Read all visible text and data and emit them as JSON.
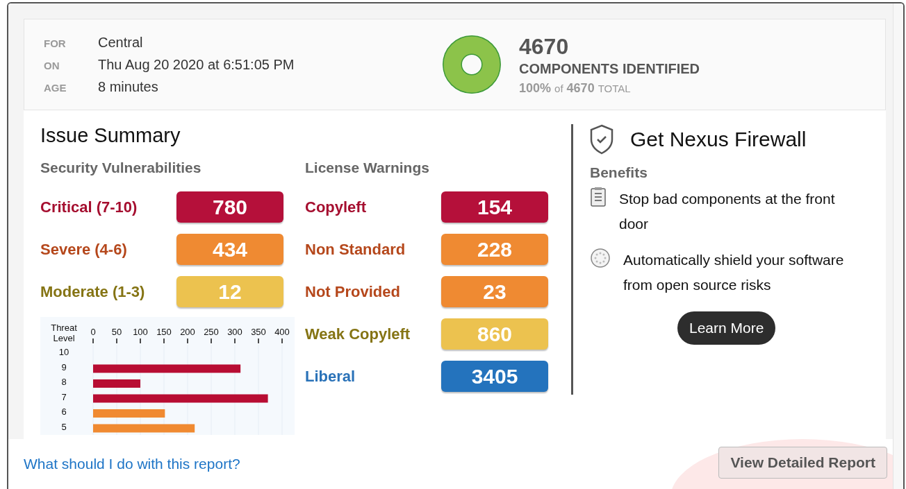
{
  "header": {
    "meta": [
      {
        "label": "FOR",
        "value": "Central"
      },
      {
        "label": "ON",
        "value": "Thu Aug 20 2020 at 6:51:05 PM"
      },
      {
        "label": "AGE",
        "value": "8 minutes"
      }
    ],
    "components": {
      "count": "4670",
      "title": "COMPONENTS IDENTIFIED",
      "percent": "100%",
      "of": "of",
      "total": "4670",
      "total_label": "TOTAL",
      "level": 1
    }
  },
  "issue_summary": {
    "title": "Issue Summary",
    "security": {
      "title": "Security Vulnerabilities",
      "rows": [
        {
          "label": "Critical (7-10)",
          "count": "780",
          "kind": "critical",
          "color": "#b5103a"
        },
        {
          "label": "Severe (4-6)",
          "count": "434",
          "kind": "severe",
          "color": "#ef8a32"
        },
        {
          "label": "Moderate (1-3)",
          "count": "12",
          "kind": "moderate",
          "color": "#ecc24f"
        }
      ]
    },
    "license": {
      "title": "License Warnings",
      "rows": [
        {
          "label": "Copyleft",
          "count": "154",
          "kind": "critical",
          "color": "#b5103a"
        },
        {
          "label": "Non Standard",
          "count": "228",
          "kind": "severe",
          "color": "#ef8a32"
        },
        {
          "label": "Not Provided",
          "count": "23",
          "kind": "severe",
          "color": "#ef8a32"
        },
        {
          "label": "Weak Copyleft",
          "count": "860",
          "kind": "moderate",
          "color": "#ecc24f"
        },
        {
          "label": "Liberal",
          "count": "3405",
          "kind": "liberal",
          "color": "#2473bd"
        }
      ]
    },
    "chart_data": {
      "type": "bar",
      "orientation": "horizontal",
      "stacked": true,
      "ylabel": "Threat Level",
      "categories": [
        "10",
        "9",
        "8",
        "7",
        "6",
        "5"
      ],
      "xlim": [
        0,
        400
      ],
      "xticks": [
        0,
        50,
        100,
        150,
        200,
        250,
        300,
        350,
        400
      ],
      "grid": true,
      "series": [
        {
          "color": "#b80d33",
          "values": [
            null,
            312,
            100,
            370,
            null,
            null
          ]
        },
        {
          "color": "#f08a31",
          "values": [
            null,
            null,
            null,
            null,
            152,
            215
          ]
        }
      ]
    }
  },
  "firewall": {
    "title": "Get Nexus Firewall",
    "benefits_title": "Benefits",
    "benefits": [
      {
        "text": "Stop bad components at the front door",
        "kind": "clipboard"
      },
      {
        "text": "Automatically shield your software from open source risks",
        "kind": "dots"
      }
    ],
    "button": "Learn More"
  },
  "footer": {
    "link": "What should I do with this report?",
    "button": "View Detailed Report"
  }
}
